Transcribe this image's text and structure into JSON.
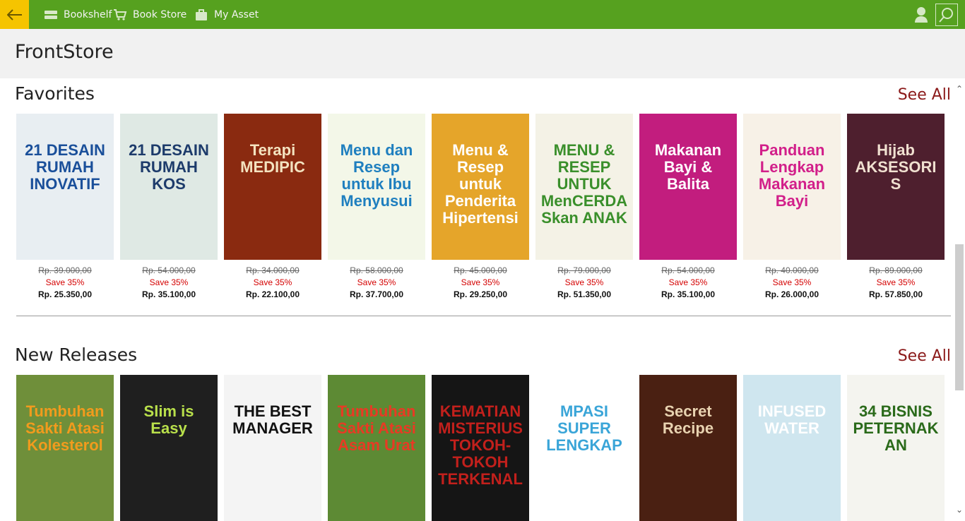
{
  "nav": {
    "items": [
      {
        "label": "Bookshelf",
        "icon": "bookshelf-icon"
      },
      {
        "label": "Book Store",
        "icon": "cart-icon"
      },
      {
        "label": "My Asset",
        "icon": "asset-bag-icon"
      }
    ]
  },
  "colors": {
    "topbar": "#56a11f",
    "back_button": "#f5c400",
    "see_all": "#8b1a1a",
    "save_text": "#d40000"
  },
  "page": {
    "title": "FrontStore"
  },
  "favorites": {
    "title": "Favorites",
    "see_all": "See All",
    "books": [
      {
        "cover_text": "21 DESAIN RUMAH INOVATIF",
        "cover_bg": "#e8eef2",
        "cover_fg": "#1a4f9a",
        "old_price": "Rp. 39.000,00",
        "save": "Save 35%",
        "price": "Rp. 25.350,00"
      },
      {
        "cover_text": "21 DESAIN RUMAH KOS",
        "cover_bg": "#dfe9e4",
        "cover_fg": "#1d3b6b",
        "old_price": "Rp. 54.000,00",
        "save": "Save 35%",
        "price": "Rp. 35.100,00"
      },
      {
        "cover_text": "Terapi MEDIPIC",
        "cover_bg": "#8a2a10",
        "cover_fg": "#f4e3c0",
        "old_price": "Rp. 34.000,00",
        "save": "Save 35%",
        "price": "Rp. 22.100,00"
      },
      {
        "cover_text": "Menu dan Resep untuk Ibu Menyusui",
        "cover_bg": "#f3f7e8",
        "cover_fg": "#1f7fbf",
        "old_price": "Rp. 58.000,00",
        "save": "Save 35%",
        "price": "Rp. 37.700,00"
      },
      {
        "cover_text": "Menu & Resep untuk Penderita Hipertensi",
        "cover_bg": "#e5a52a",
        "cover_fg": "#ffffff",
        "old_price": "Rp. 45.000,00",
        "save": "Save 35%",
        "price": "Rp. 29.250,00"
      },
      {
        "cover_text": "MENU & RESEP UNTUK MenCERDASkan ANAK",
        "cover_bg": "#f4f2e6",
        "cover_fg": "#3a8f2b",
        "old_price": "Rp. 79.000,00",
        "save": "Save 35%",
        "price": "Rp. 51.350,00"
      },
      {
        "cover_text": "Makanan Bayi & Balita",
        "cover_bg": "#c21d7e",
        "cover_fg": "#ffffff",
        "old_price": "Rp. 54.000,00",
        "save": "Save 35%",
        "price": "Rp. 35.100,00"
      },
      {
        "cover_text": "Panduan Lengkap Makanan Bayi",
        "cover_bg": "#f7f1e7",
        "cover_fg": "#d21f8a",
        "old_price": "Rp. 40.000,00",
        "save": "Save 35%",
        "price": "Rp. 26.000,00"
      },
      {
        "cover_text": "Hijab AKSESORIS",
        "cover_bg": "#4e1f2e",
        "cover_fg": "#f0e0d0",
        "old_price": "Rp. 89.000,00",
        "save": "Save 35%",
        "price": "Rp. 57.850,00"
      }
    ]
  },
  "new_releases": {
    "title": "New Releases",
    "see_all": "See All",
    "books": [
      {
        "cover_text": "Tumbuhan Sakti Atasi Kolesterol",
        "cover_bg": "#6f8f3a",
        "cover_fg": "#f29b1d"
      },
      {
        "cover_text": "Slim is Easy",
        "cover_bg": "#1f1f1f",
        "cover_fg": "#b9e04b"
      },
      {
        "cover_text": "THE BEST MANAGER",
        "cover_bg": "#f4f4f4",
        "cover_fg": "#111111"
      },
      {
        "cover_text": "Tumbuhan Sakti Atasi Asam Urat",
        "cover_bg": "#5d8a34",
        "cover_fg": "#e83a24"
      },
      {
        "cover_text": "KEMATIAN MISTERIUS TOKOH-TOKOH TERKENAL",
        "cover_bg": "#151515",
        "cover_fg": "#c2201c"
      },
      {
        "cover_text": "MPASI SUPER LENGKAP",
        "cover_bg": "#ffffff",
        "cover_fg": "#3aa5d8"
      },
      {
        "cover_text": "Secret Recipe",
        "cover_bg": "#4a2012",
        "cover_fg": "#e8d2b0"
      },
      {
        "cover_text": "INFUSED WATER",
        "cover_bg": "#cfe6ef",
        "cover_fg": "#ffffff"
      },
      {
        "cover_text": "34 BISNIS PETERNAKAN",
        "cover_bg": "#f4f4ef",
        "cover_fg": "#2a6a1a"
      }
    ]
  }
}
